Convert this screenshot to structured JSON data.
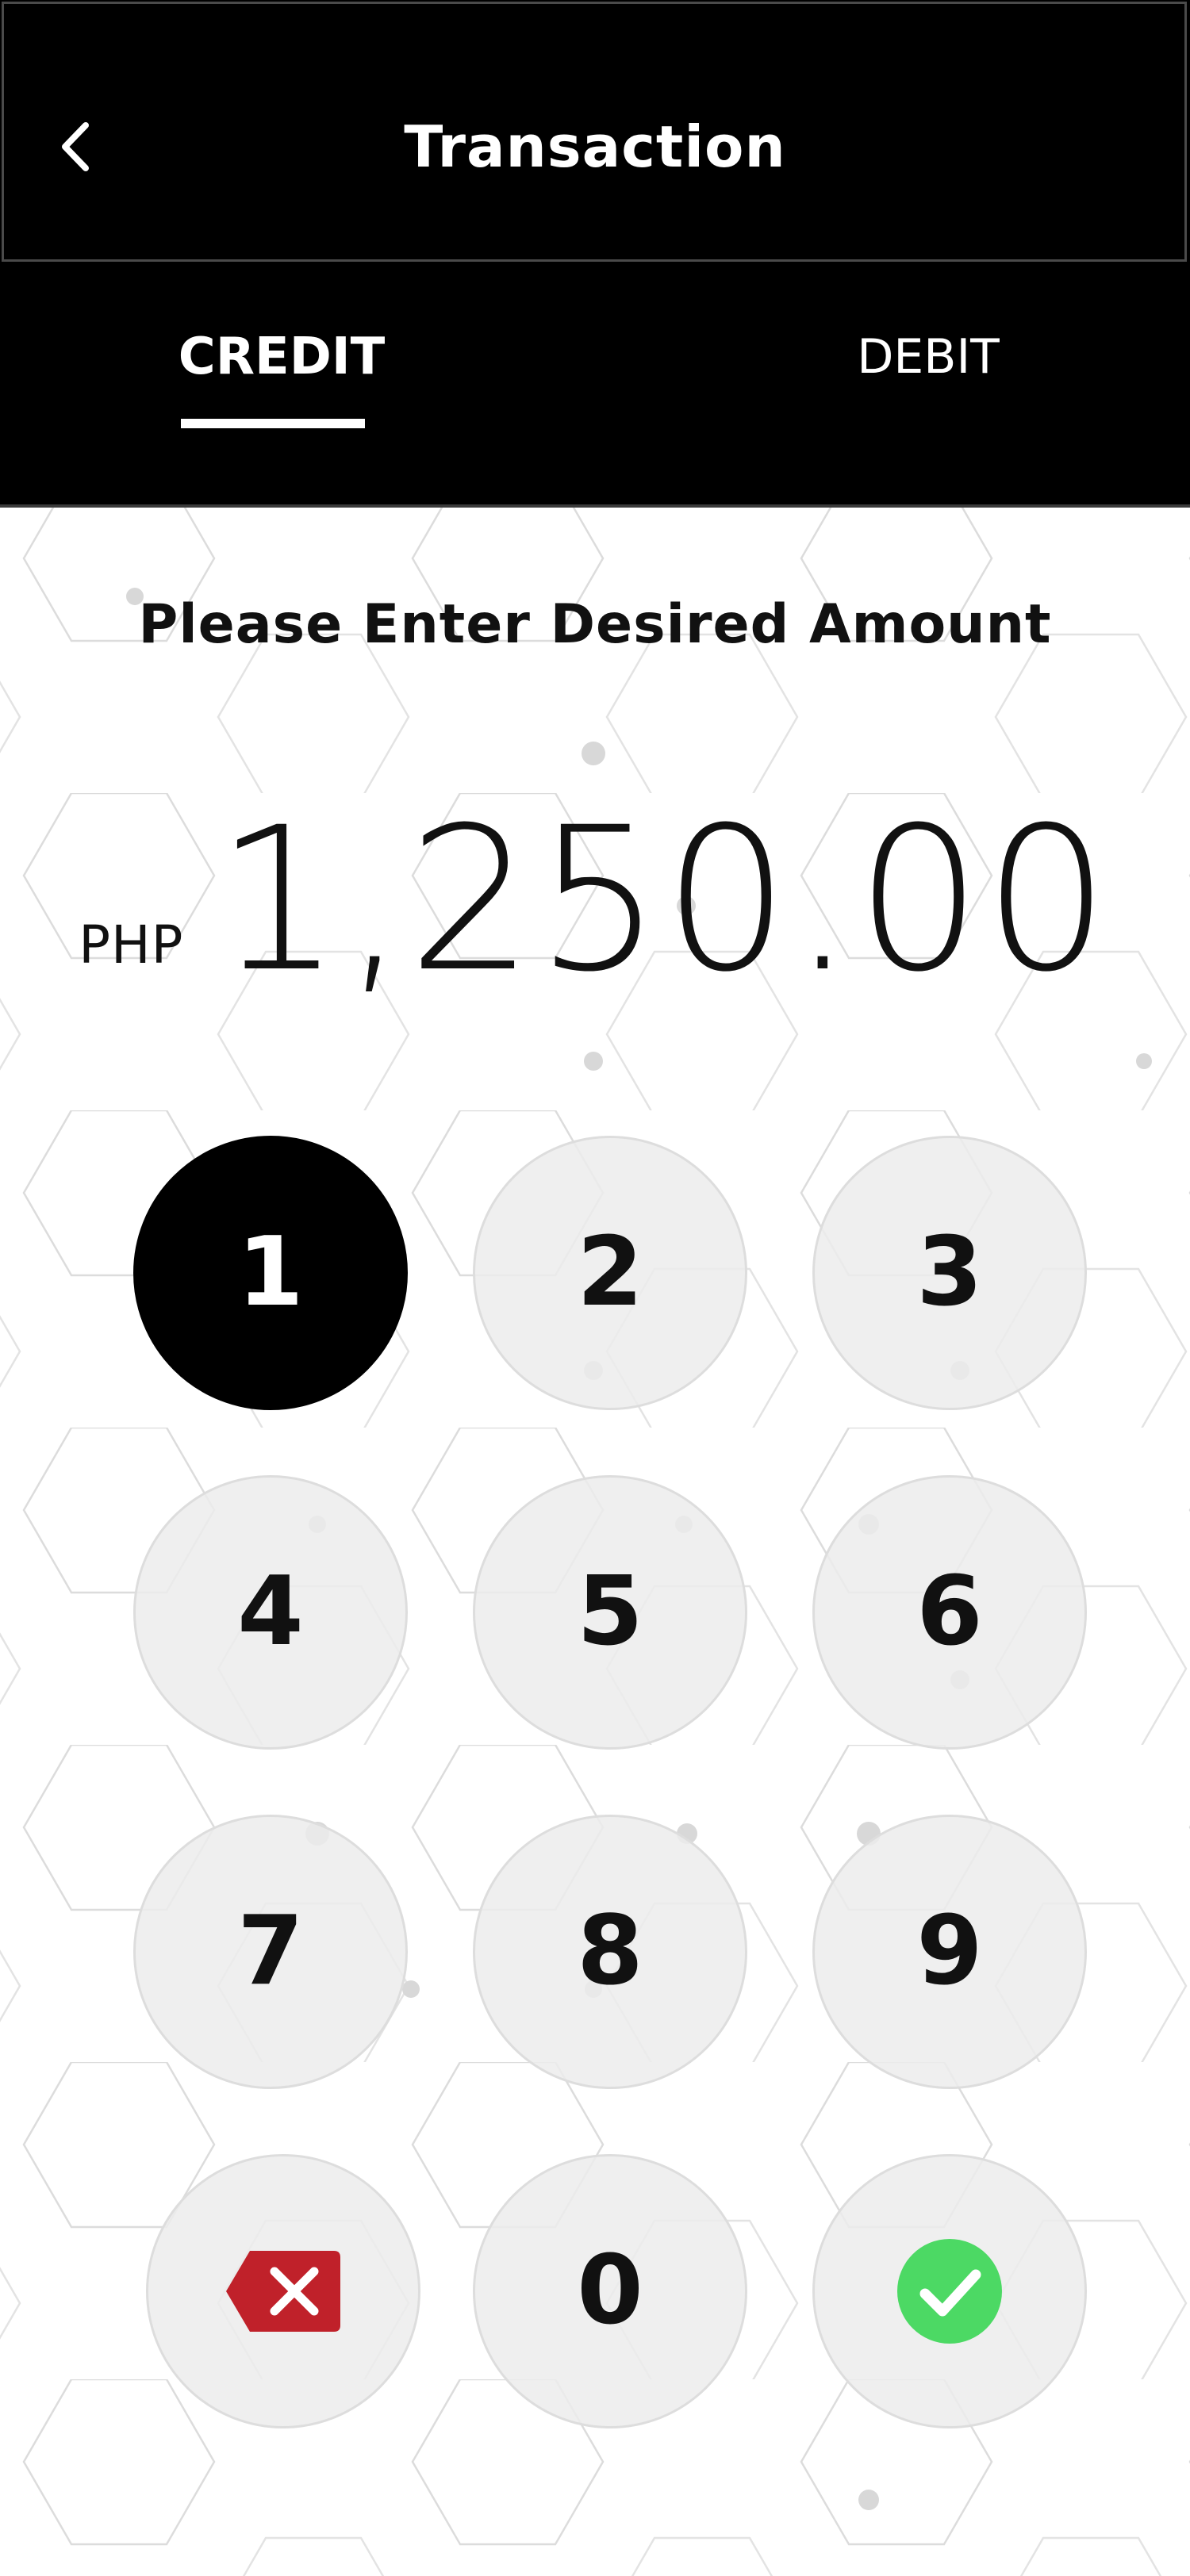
{
  "header": {
    "title": "Transaction",
    "back_icon": "chevron-left-icon"
  },
  "tabs": [
    {
      "label": "CREDIT",
      "active": true
    },
    {
      "label": "DEBIT",
      "active": false
    }
  ],
  "prompt": "Please Enter Desired Amount",
  "amount": {
    "currency": "PHP",
    "value": "1,250.00"
  },
  "keypad": {
    "keys": [
      "1",
      "2",
      "3",
      "4",
      "5",
      "6",
      "7",
      "8",
      "9",
      "0"
    ],
    "pressed_key": "1",
    "delete_icon": "backspace-delete-icon",
    "confirm_icon": "check-circle-icon"
  },
  "colors": {
    "header_bg": "#000000",
    "key_bg": "#ececec",
    "key_active_bg": "#000000",
    "delete_red": "#c0212a",
    "confirm_green": "#4cd964"
  }
}
